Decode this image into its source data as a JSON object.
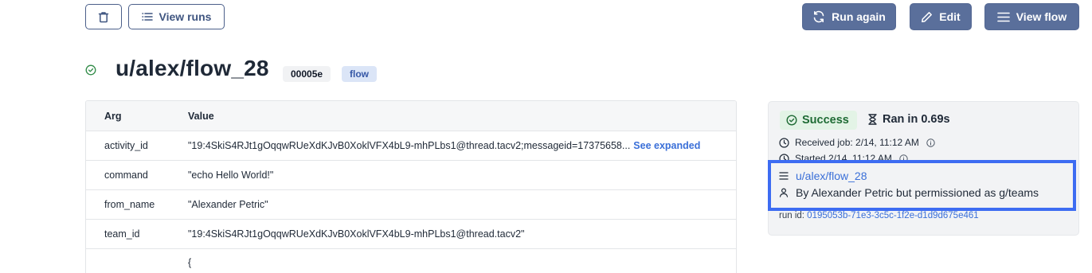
{
  "toolbar": {
    "view_runs_label": "View runs",
    "run_again_label": "Run again",
    "edit_label": "Edit",
    "view_flow_label": "View flow"
  },
  "header": {
    "path": "u/alex/flow_28",
    "job_id": "00005e",
    "kind_badge": "flow"
  },
  "args_table": {
    "headers": {
      "arg": "Arg",
      "value": "Value"
    },
    "rows": [
      {
        "arg": "activity_id",
        "value": "\"19:4SkiS4RJt1gOqqwRUeXdKJvB0XoklVFX4bL9-mhPLbs1@thread.tacv2;messageid=17375658...",
        "link": "See expanded"
      },
      {
        "arg": "command",
        "value": "\"echo Hello World!\""
      },
      {
        "arg": "from_name",
        "value": "\"Alexander Petric\""
      },
      {
        "arg": "team_id",
        "value": "\"19:4SkiS4RJt1gOqqwRUeXdKJvB0XoklVFX4bL9-mhPLbs1@thread.tacv2\""
      },
      {
        "arg": "",
        "value": "{"
      }
    ]
  },
  "status_panel": {
    "status": "Success",
    "ran_in": "Ran in 0.69s",
    "received": "Received job: 2/14, 11:12 AM",
    "started": "Started 2/14, 11:12 AM",
    "flow_path": "u/alex/flow_28",
    "permissions": "By Alexander Petric but permissioned as g/teams",
    "run_id_label": "run id:",
    "run_id": "0195053b-71e3-3c5c-1f2e-d1d9d675e461"
  },
  "colors": {
    "primary_button": "#5a6f9b",
    "link": "#3a6fd8",
    "success_bg": "#e3f3e6",
    "success_text": "#1f6b35",
    "highlight_border": "#3d6cf2"
  }
}
